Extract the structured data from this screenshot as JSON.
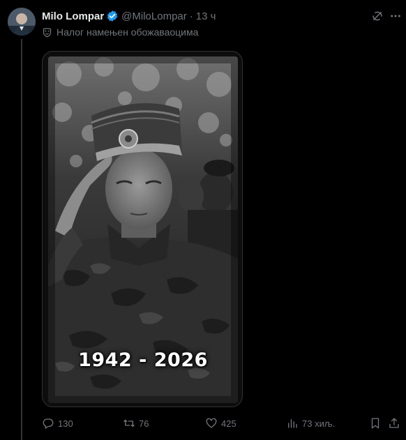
{
  "post": {
    "display_name": "Milo Lompar",
    "handle": "@MiloLompar",
    "separator": "·",
    "time": "13 ч",
    "subscriber_label": "Налог намењен обожаваоцима",
    "photo_caption": "1942 - 2026"
  },
  "actions": {
    "reply_count": "130",
    "repost_count": "76",
    "like_count": "425",
    "views_count": "73 хиљ."
  },
  "icons": {
    "verified": "verified-badge-icon",
    "grok": "grok-icon",
    "more": "more-icon",
    "subscriber": "mask-icon",
    "reply": "reply-icon",
    "repost": "repost-icon",
    "like": "heart-icon",
    "views": "views-icon",
    "bookmark": "bookmark-icon",
    "share": "share-icon"
  },
  "colors": {
    "background": "#000000",
    "text_primary": "#e7e9ea",
    "text_secondary": "#71767b",
    "verified_blue": "#1d9bf0",
    "border": "#2f3336"
  }
}
